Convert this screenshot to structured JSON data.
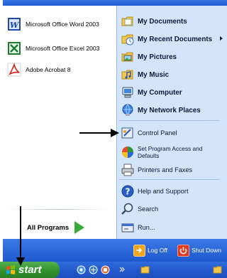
{
  "left": {
    "programs": [
      {
        "label": "Microsoft Office Word 2003",
        "icon": "word-icon"
      },
      {
        "label": "Microsoft Office Excel 2003",
        "icon": "excel-icon"
      },
      {
        "label": "Adobe Acrobat 8",
        "icon": "acrobat-icon"
      }
    ],
    "all_programs_label": "All Programs"
  },
  "right": {
    "items": [
      {
        "label": "My Documents",
        "icon": "my-documents-icon"
      },
      {
        "label": "My Recent Documents",
        "icon": "recent-documents-icon"
      },
      {
        "label": "My Pictures",
        "icon": "my-pictures-icon"
      },
      {
        "label": "My Music",
        "icon": "my-music-icon"
      },
      {
        "label": "My Computer",
        "icon": "my-computer-icon"
      },
      {
        "label": "My Network Places",
        "icon": "network-places-icon"
      },
      {
        "label": "Control Panel",
        "icon": "control-panel-icon"
      },
      {
        "label": "Set Program Access and Defaults",
        "icon": "program-access-icon"
      },
      {
        "label": "Printers and Faxes",
        "icon": "printers-icon"
      },
      {
        "label": "Help and Support",
        "icon": "help-icon"
      },
      {
        "label": "Search",
        "icon": "search-icon"
      },
      {
        "label": "Run...",
        "icon": "run-icon"
      }
    ]
  },
  "bottom": {
    "log_off_label": "Log Off",
    "shut_down_label": "Shut Down"
  },
  "taskbar": {
    "start_label": "start"
  }
}
